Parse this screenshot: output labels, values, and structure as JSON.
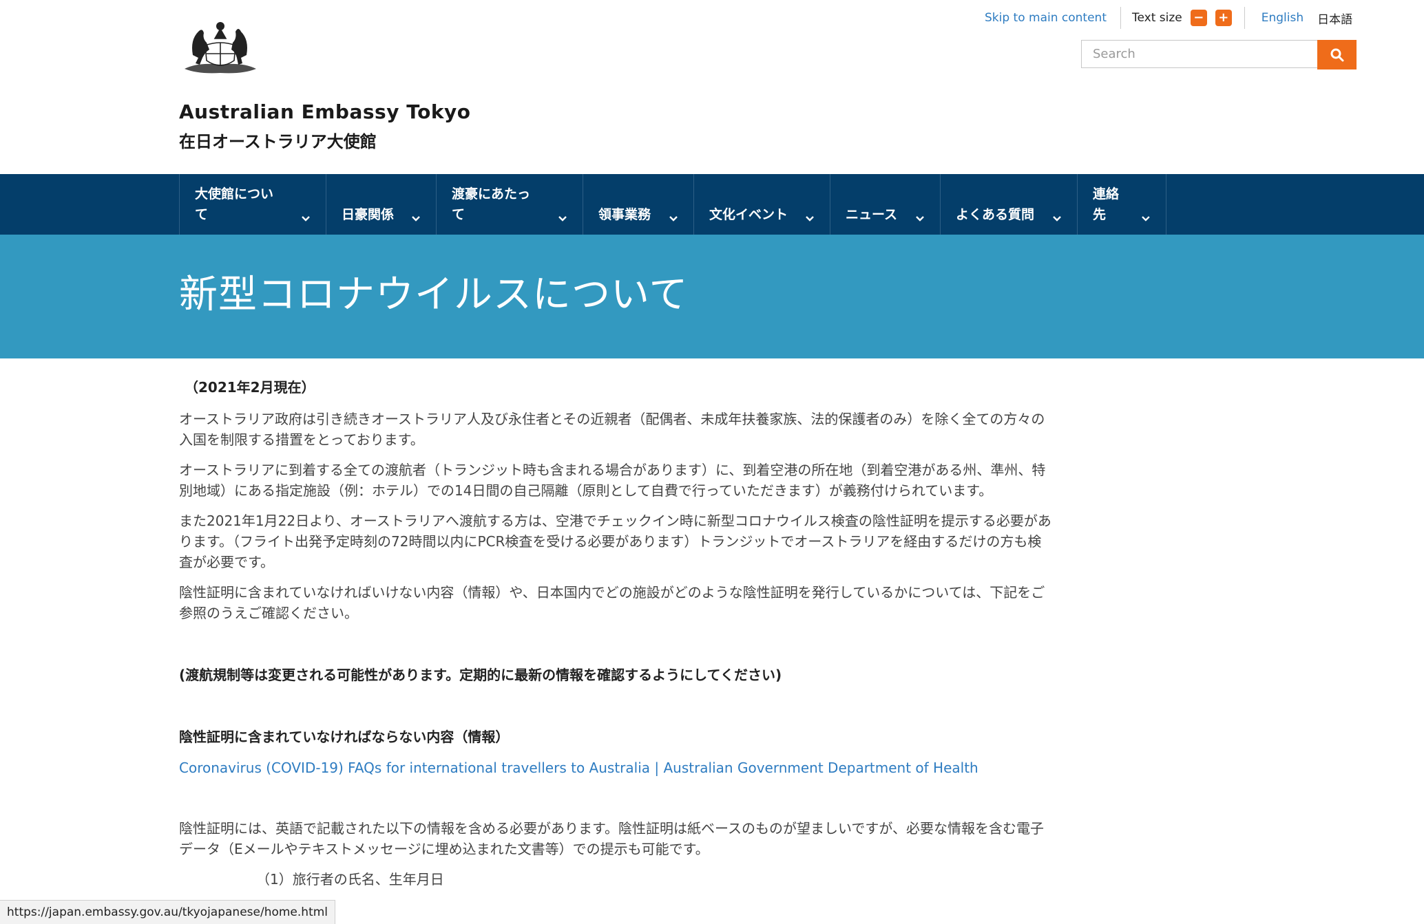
{
  "header": {
    "site_title": "Australian Embassy Tokyo",
    "site_subtitle": "在日オーストラリア大使館",
    "skip_link": "Skip to main content",
    "text_size_label": "Text size",
    "text_size_decrease": "−",
    "text_size_increase": "+",
    "lang_english": "English",
    "lang_japanese": "日本語",
    "search_placeholder": "Search"
  },
  "nav": {
    "items": [
      {
        "label": "大使館について"
      },
      {
        "label": "日豪関係"
      },
      {
        "label": "渡豪にあたって"
      },
      {
        "label": "領事業務"
      },
      {
        "label": "文化イベント"
      },
      {
        "label": "ニュース"
      },
      {
        "label": "よくある質問"
      },
      {
        "label": "連絡先"
      }
    ]
  },
  "banner": {
    "title": "新型コロナウイルスについて"
  },
  "content": {
    "date": "（2021年2月現在）",
    "para1": "オーストラリア政府は引き続きオーストラリア人及び永住者とその近親者（配偶者、未成年扶養家族、法的保護者のみ）を除く全ての方々の入国を制限する措置をとっております。",
    "para2": "オーストラリアに到着する全ての渡航者（トランジット時も含まれる場合があります）に、到着空港の所在地（到着空港がある州、準州、特別地域）にある指定施設（例：ホテル）での14日間の自己隔離（原則として自費で行っていただきます）が義務付けられています。",
    "para3": "また2021年1月22日より、オーストラリアへ渡航する方は、空港でチェックイン時に新型コロナウイルス検査の陰性証明を提示する必要があります。（フライト出発予定時刻の72時間以内にPCR検査を受ける必要があります）トランジットでオーストラリアを経由するだけの方も検査が必要です。",
    "para4": "陰性証明に含まれていなければいけない内容（情報）や、日本国内でどの施設がどのような陰性証明を発行しているかについては、下記をご参照のうえご確認ください。",
    "note": "(渡航規制等は変更される可能性があります。定期的に最新の情報を確認するようにしてください)",
    "section_heading": "陰性証明に含まれていなければならない内容（情報）",
    "link_text": "Coronavirus (COVID-19) FAQs for international travellers to Australia | Australian Government Department of Health",
    "para5": "陰性証明には、英語で記載された以下の情報を含める必要があります。陰性証明は紙ベースのものが望ましいですが、必要な情報を含む電子データ（Eメールやテキストメッセージに埋め込まれた文書等）での提示も可能です。",
    "list_item1": "（1）旅行者の氏名、生年月日"
  },
  "status_bar": {
    "url": "https://japan.embassy.gov.au/tkyojapanese/home.html"
  },
  "colors": {
    "nav_bg": "#043e6a",
    "banner_bg": "#3399c0",
    "accent_orange": "#ef6c1a",
    "link_blue": "#2e7cc1"
  }
}
